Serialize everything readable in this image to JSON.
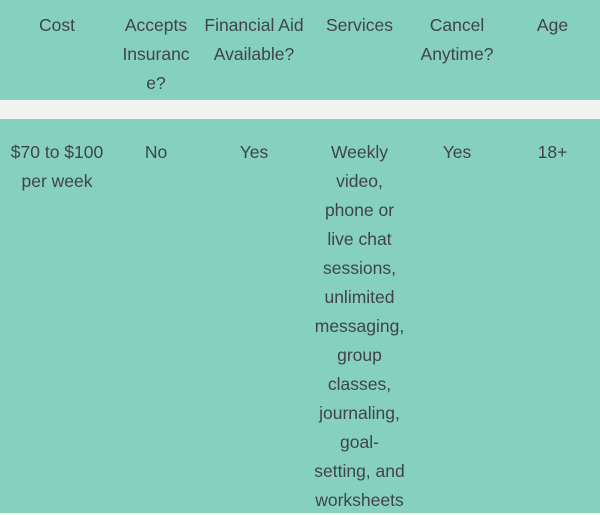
{
  "table": {
    "columns": [
      {
        "key": "cost",
        "header": "Cost"
      },
      {
        "key": "insurance",
        "header": "Accepts Insurance?"
      },
      {
        "key": "aid",
        "header": "Financial Aid Available?"
      },
      {
        "key": "services",
        "header": "Services"
      },
      {
        "key": "cancel",
        "header": "Cancel Anytime?"
      },
      {
        "key": "age",
        "header": "Age"
      }
    ],
    "rows": [
      {
        "cost": "$70 to $100 per week",
        "insurance": "No",
        "aid": "Yes",
        "services": "Weekly video, phone or live chat sessions, unlimited messaging, group classes, journaling, goal-setting, and worksheets",
        "cancel": "Yes",
        "age": "18+"
      }
    ]
  },
  "colors": {
    "band": "#85d0bf",
    "gap": "#f2f2f0",
    "text": "#404448"
  }
}
